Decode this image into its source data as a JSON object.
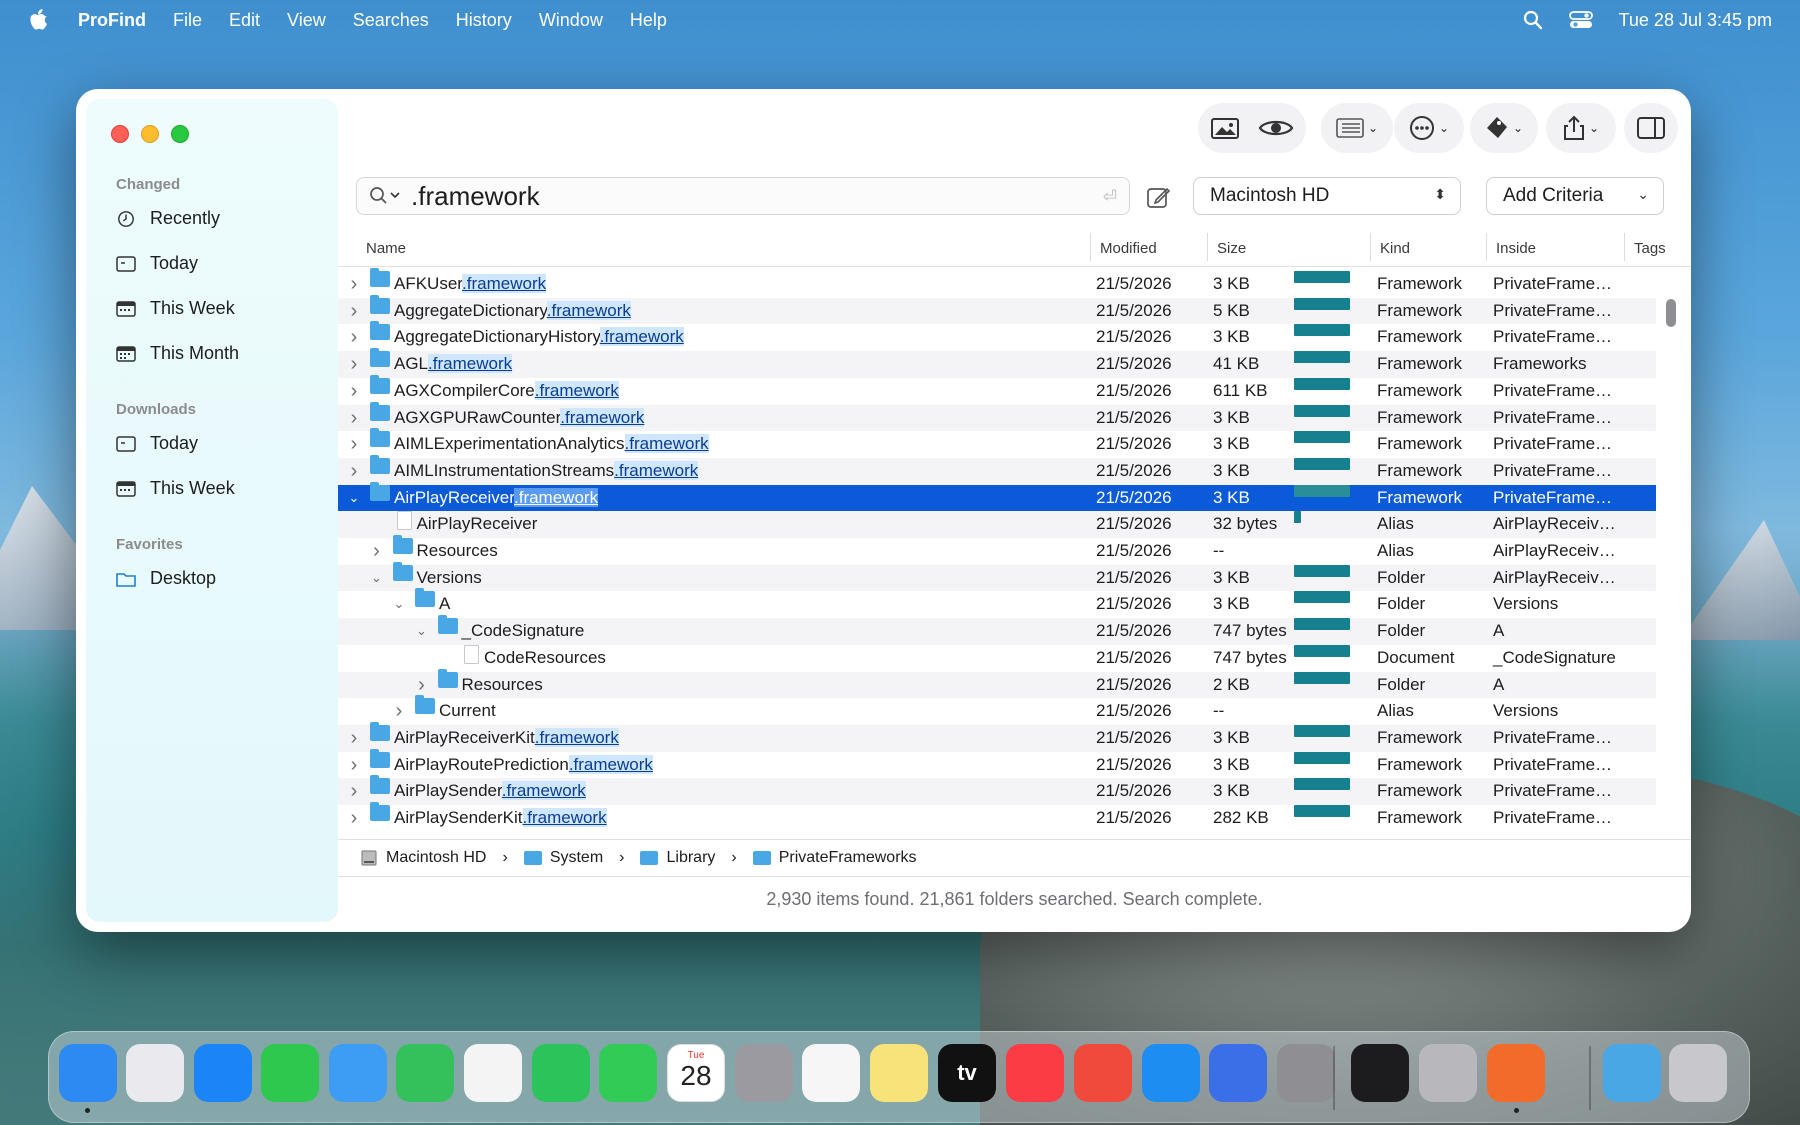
{
  "menubar": {
    "app_name": "ProFind",
    "menus": [
      "File",
      "Edit",
      "View",
      "Searches",
      "History",
      "Window",
      "Help"
    ],
    "datetime": "Tue 28 Jul  3:45 pm"
  },
  "sidebar": {
    "sections": [
      {
        "title": "Changed",
        "items": [
          "Recently",
          "Today",
          "This Week",
          "This Month"
        ]
      },
      {
        "title": "Downloads",
        "items": [
          "Today",
          "This Week"
        ]
      },
      {
        "title": "Favorites",
        "items": [
          "Desktop"
        ]
      }
    ]
  },
  "search": {
    "query": ".framework",
    "scope": "Macintosh HD",
    "add_criteria": "Add Criteria"
  },
  "table": {
    "columns": [
      "Name",
      "Modified",
      "Size",
      "Kind",
      "Inside",
      "Tags"
    ],
    "rows": [
      {
        "base": "AFKUser",
        "match": ".framework",
        "modified": "21/5/2026",
        "size": "3 KB",
        "kind": "Framework",
        "inside": "PrivateFrame…",
        "bar": 0.08
      },
      {
        "base": "AggregateDictionary",
        "match": ".framework",
        "modified": "21/5/2026",
        "size": "5 KB",
        "kind": "Framework",
        "inside": "PrivateFrame…",
        "bar": 0.08
      },
      {
        "base": "AggregateDictionaryHistory",
        "match": ".framework",
        "modified": "21/5/2026",
        "size": "3 KB",
        "kind": "Framework",
        "inside": "PrivateFrame…",
        "bar": 0.08
      },
      {
        "base": "AGL",
        "match": ".framework",
        "modified": "21/5/2026",
        "size": "41 KB",
        "kind": "Framework",
        "inside": "Frameworks",
        "bar": 0.08
      },
      {
        "base": "AGXCompilerCore",
        "match": ".framework",
        "modified": "21/5/2026",
        "size": "611 KB",
        "kind": "Framework",
        "inside": "PrivateFrame…",
        "bar": 0.08
      },
      {
        "base": "AGXGPURawCounter",
        "match": ".framework",
        "modified": "21/5/2026",
        "size": "3 KB",
        "kind": "Framework",
        "inside": "PrivateFrame…",
        "bar": 0.08
      },
      {
        "base": "AIMLExperimentationAnalytics",
        "match": ".framework",
        "modified": "21/5/2026",
        "size": "3 KB",
        "kind": "Framework",
        "inside": "PrivateFrame…",
        "bar": 0.08
      },
      {
        "base": "AIMLInstrumentationStreams",
        "match": ".framework",
        "modified": "21/5/2026",
        "size": "3 KB",
        "kind": "Framework",
        "inside": "PrivateFrame…",
        "bar": 0.08
      },
      {
        "base": "AirPlayReceiver",
        "match": ".framework",
        "modified": "21/5/2026",
        "size": "3 KB",
        "kind": "Framework",
        "inside": "PrivateFrame…",
        "bar": 0.08,
        "selected": true,
        "expanded": true
      },
      {
        "base": "AirPlayReceiver",
        "match": "",
        "modified": "21/5/2026",
        "size": "32 bytes",
        "kind": "Alias",
        "inside": "AirPlayReceiv…",
        "bar": 0.01,
        "depth": 1,
        "doc": true
      },
      {
        "base": "Resources",
        "match": "",
        "modified": "21/5/2026",
        "size": "--",
        "kind": "Alias",
        "inside": "AirPlayReceiv…",
        "bar": 0,
        "depth": 1
      },
      {
        "base": "Versions",
        "match": "",
        "modified": "21/5/2026",
        "size": "3 KB",
        "kind": "Folder",
        "inside": "AirPlayReceiv…",
        "bar": 0.08,
        "depth": 1,
        "expanded": true
      },
      {
        "base": "A",
        "match": "",
        "modified": "21/5/2026",
        "size": "3 KB",
        "kind": "Folder",
        "inside": "Versions",
        "bar": 0.08,
        "depth": 2,
        "expanded": true
      },
      {
        "base": "_CodeSignature",
        "match": "",
        "modified": "21/5/2026",
        "size": "747 bytes",
        "kind": "Folder",
        "inside": "A",
        "bar": 0.08,
        "depth": 3,
        "expanded": true
      },
      {
        "base": "CodeResources",
        "match": "",
        "modified": "21/5/2026",
        "size": "747 bytes",
        "kind": "Document",
        "inside": "_CodeSignature",
        "bar": 0.08,
        "depth": 4,
        "doc": true
      },
      {
        "base": "Resources",
        "match": "",
        "modified": "21/5/2026",
        "size": "2 KB",
        "kind": "Folder",
        "inside": "A",
        "bar": 0.08,
        "depth": 3
      },
      {
        "base": "Current",
        "match": "",
        "modified": "21/5/2026",
        "size": "--",
        "kind": "Alias",
        "inside": "Versions",
        "bar": 0,
        "depth": 2
      },
      {
        "base": "AirPlayReceiverKit",
        "match": ".framework",
        "modified": "21/5/2026",
        "size": "3 KB",
        "kind": "Framework",
        "inside": "PrivateFrame…",
        "bar": 0.08
      },
      {
        "base": "AirPlayRoutePrediction",
        "match": ".framework",
        "modified": "21/5/2026",
        "size": "3 KB",
        "kind": "Framework",
        "inside": "PrivateFrame…",
        "bar": 0.08
      },
      {
        "base": "AirPlaySender",
        "match": ".framework",
        "modified": "21/5/2026",
        "size": "3 KB",
        "kind": "Framework",
        "inside": "PrivateFrame…",
        "bar": 0.08
      },
      {
        "base": "AirPlaySenderKit",
        "match": ".framework",
        "modified": "21/5/2026",
        "size": "282 KB",
        "kind": "Framework",
        "inside": "PrivateFrame…",
        "bar": 0.08
      }
    ]
  },
  "pathbar": [
    "Macintosh HD",
    "System",
    "Library",
    "PrivateFrameworks"
  ],
  "status": "2,930 items found. 21,861 folders searched. Search complete.",
  "dock": {
    "apps": [
      "Finder",
      "Launchpad",
      "Safari",
      "Messages",
      "Mail",
      "Maps",
      "Photos",
      "FaceTime",
      "Phone",
      "Calendar",
      "Contacts",
      "Reminders",
      "Notes",
      "TV",
      "Music",
      "Rocket",
      "App Store",
      "iPhone Mirroring",
      "System Settings",
      "Terminal",
      "Proxyman",
      "ProFind",
      "Downloads",
      "Trash"
    ],
    "calendar_month": "Tue",
    "calendar_day": "28",
    "tv_label": "tv"
  },
  "colors": {
    "selection": "#0b5ad8",
    "size_bar": "#16808f",
    "folder": "#4aa7e6",
    "match_highlight": "#cfe6ff"
  }
}
